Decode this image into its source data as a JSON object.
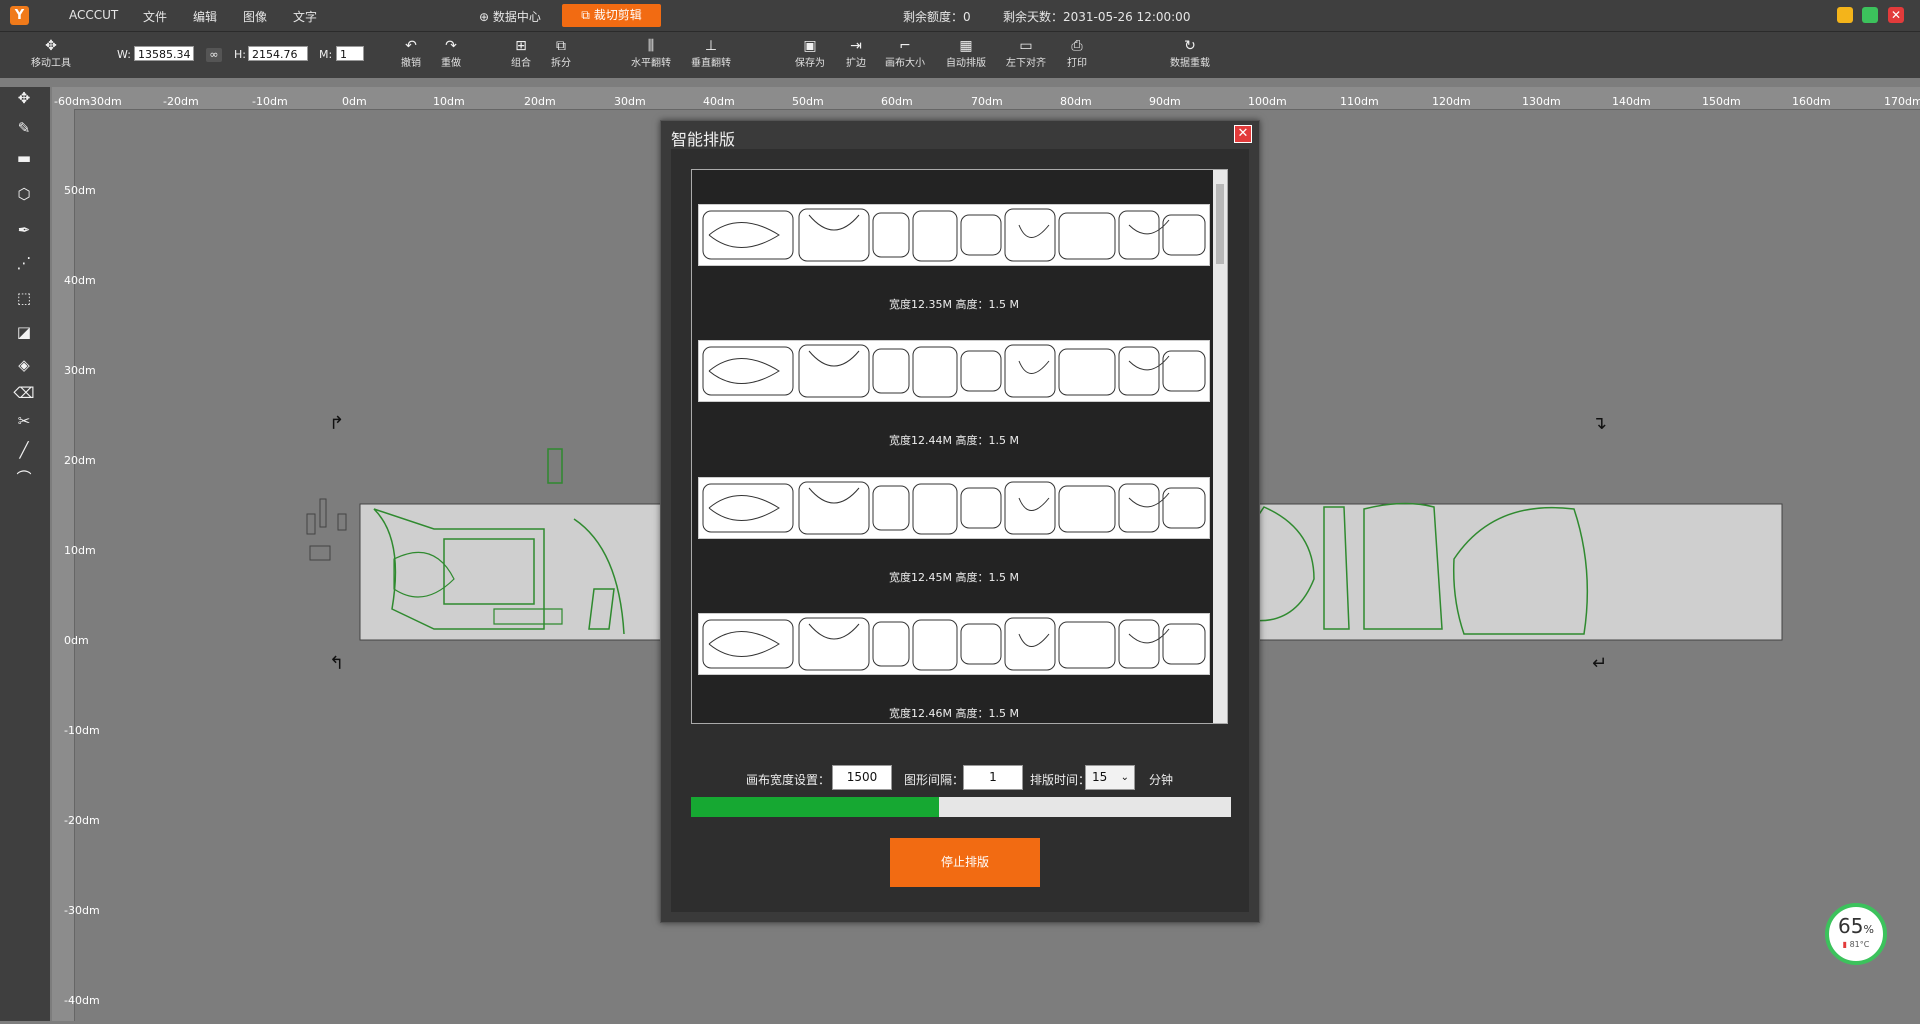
{
  "titlebar": {
    "app_name": "ACCCUT",
    "menu": [
      "文件",
      "编辑",
      "图像",
      "文字"
    ],
    "data_center": "数据中心",
    "cut_edit": "裁切剪辑",
    "quota": "剩余额度：0",
    "days_left": "剩余天数：2031-05-26 12:00:00"
  },
  "toolbar": {
    "move_tool": "移动工具",
    "w_label": "W:",
    "w_value": "13585.34",
    "h_label": "H:",
    "h_value": "2154.76",
    "m_label": "M:",
    "m_value": "1",
    "undo": "撤销",
    "redo": "重做",
    "combine": "组合",
    "split": "拆分",
    "flip_h": "水平翻转",
    "flip_v": "垂直翻转",
    "save_as": "保存为",
    "expand": "扩边",
    "canvas_size": "画布大小",
    "auto_layout": "自动排版",
    "align_bl": "左下对齐",
    "print": "打印",
    "reload": "数据重载"
  },
  "ruler": {
    "top": [
      "-60dm",
      "-30dm",
      "-20dm",
      "-10dm",
      "0dm",
      "10dm",
      "20dm",
      "30dm",
      "40dm",
      "50dm",
      "60dm",
      "70dm",
      "80dm",
      "90dm",
      "100dm",
      "110dm",
      "120dm",
      "130dm",
      "140dm",
      "150dm",
      "160dm",
      "170dm"
    ],
    "left": [
      "50dm",
      "40dm",
      "30dm",
      "20dm",
      "10dm",
      "0dm",
      "-10dm",
      "-20dm",
      "-30dm",
      "-40dm"
    ]
  },
  "dialog": {
    "title": "智能排版",
    "results": [
      "宽度12.35M 高度：1.5 M",
      "宽度12.44M 高度：1.5 M",
      "宽度12.45M 高度：1.5 M",
      "宽度12.46M 高度：1.5 M"
    ],
    "canvas_width_label": "画布宽度设置：",
    "canvas_width_value": "1500",
    "spacing_label": "图形间隔：",
    "spacing_value": "1",
    "time_label": "排版时间：",
    "time_value": "15",
    "time_unit": "分钟",
    "progress_percent": 46,
    "stop_button": "停止排版"
  },
  "temperature": {
    "percent": "65",
    "pct_sign": "%",
    "celsius": "81°C"
  },
  "colors": {
    "accent": "#f26b12",
    "progress": "#16a832",
    "outline": "#2f8a2f"
  }
}
